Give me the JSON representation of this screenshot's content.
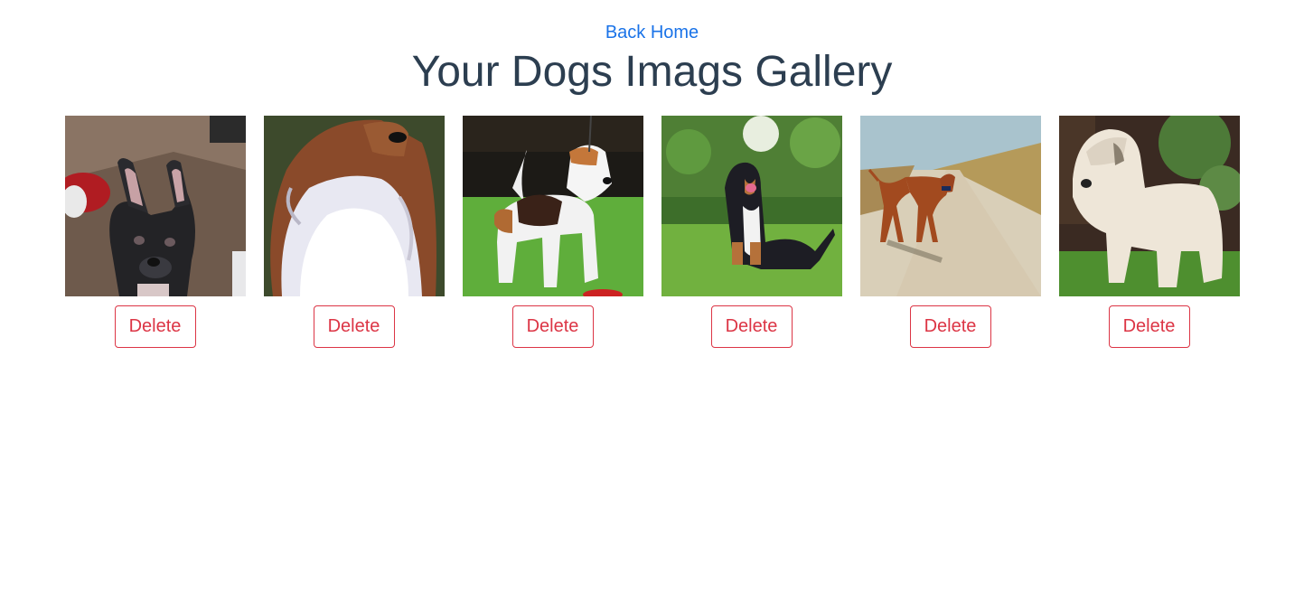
{
  "nav": {
    "back_home_label": "Back Home"
  },
  "page": {
    "title": "Your Dogs Imags Gallery"
  },
  "gallery": {
    "items": [
      {
        "dog": "french-bulldog",
        "delete_label": "Delete"
      },
      {
        "dog": "sheltie",
        "delete_label": "Delete"
      },
      {
        "dog": "wire-fox-terrier",
        "delete_label": "Delete"
      },
      {
        "dog": "entlebucher-mountain-dog",
        "delete_label": "Delete"
      },
      {
        "dog": "rhodesian-ridgeback",
        "delete_label": "Delete"
      },
      {
        "dog": "soft-coated-wheaten-terrier",
        "delete_label": "Delete"
      }
    ]
  },
  "colors": {
    "link": "#1a73e8",
    "title": "#2c3e50",
    "danger": "#dc3545"
  }
}
